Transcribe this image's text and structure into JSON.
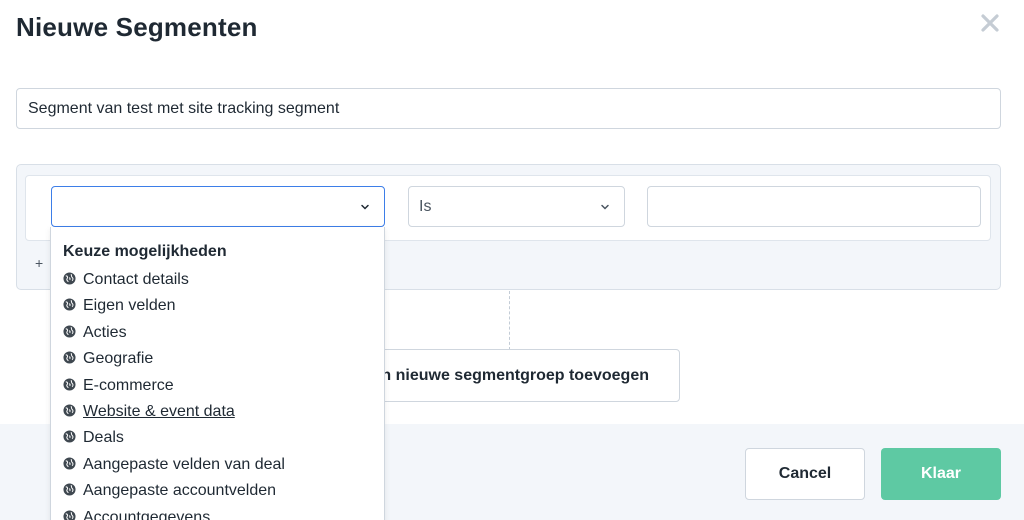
{
  "modal": {
    "title": "Nieuwe Segmenten",
    "close_icon": "close-icon"
  },
  "segment_name": {
    "value": "Segment van test met site tracking segment"
  },
  "condition": {
    "field_value": "",
    "operator_value": "Is",
    "value_input": "",
    "add_plus": "+"
  },
  "add_group_button": {
    "label": "n nieuwe segmentgroep toevoegen"
  },
  "dropdown": {
    "heading": "Keuze mogelijkheden",
    "items": [
      {
        "label": "Contact details"
      },
      {
        "label": "Eigen velden"
      },
      {
        "label": "Acties"
      },
      {
        "label": "Geografie"
      },
      {
        "label": "E-commerce"
      },
      {
        "label": "Website & event data"
      },
      {
        "label": "Deals"
      },
      {
        "label": "Aangepaste velden van deal"
      },
      {
        "label": "Aangepaste accountvelden"
      },
      {
        "label": "Accountgegevens"
      }
    ],
    "item_icon": "globe-icon"
  },
  "footer": {
    "cancel_label": "Cancel",
    "done_label": "Klaar"
  },
  "colors": {
    "primary_blue": "#3d7ee8",
    "done_green": "#5ec9a3",
    "panel_bg": "#f3f6fa"
  }
}
